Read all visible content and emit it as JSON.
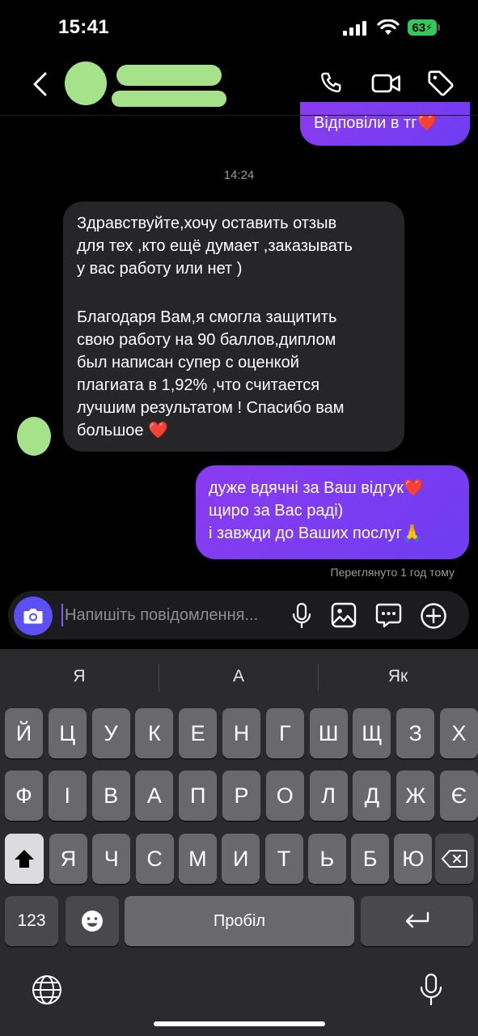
{
  "status_bar": {
    "time": "15:41",
    "battery": "63"
  },
  "chat": {
    "previous_out": "Відповіли в тг❤️",
    "timestamp": "14:24",
    "incoming": {
      "paragraph1": [
        "Здравствуйте,хочу оставить отзыв",
        "для тех ,кто ещё думает ,заказывать",
        "у вас работу или нет )"
      ],
      "paragraph2": [
        "Благодаря Вам,я смогла защитить",
        "свою работу на 90 баллов,диплом",
        "был написан супер с оценкой",
        "плагиата в 1,92% ,что считается",
        "лучшим результатом ! Спасибо вам",
        "большое ❤️"
      ]
    },
    "outgoing": [
      "дуже вдячні за Ваш відгук❤️",
      "щиро за Вас раді)",
      "і завжди до Ваших послуг🙏"
    ],
    "seen": "Переглянуто 1 год тому"
  },
  "composer": {
    "placeholder": "Напишіть повідомлення..."
  },
  "keyboard": {
    "suggestions": [
      "Я",
      "А",
      "Як"
    ],
    "row1": [
      "Й",
      "Ц",
      "У",
      "К",
      "Е",
      "Н",
      "Г",
      "Ш",
      "Щ",
      "З",
      "Х"
    ],
    "row2": [
      "Ф",
      "І",
      "В",
      "А",
      "П",
      "Р",
      "О",
      "Л",
      "Д",
      "Ж",
      "Є"
    ],
    "row3": [
      "Я",
      "Ч",
      "С",
      "М",
      "И",
      "Т",
      "Ь",
      "Б",
      "Ю"
    ],
    "numbers_label": "123",
    "space_label": "Пробіл"
  },
  "icons": {
    "back": "chevron-left-icon",
    "call": "phone-icon",
    "video": "video-icon",
    "tag": "tag-icon",
    "camera": "camera-icon",
    "mic": "mic-icon",
    "gallery": "image-icon",
    "sticker": "chat-bubble-icon",
    "plus": "plus-circle-icon"
  },
  "colors": {
    "accent": "#7c3aed",
    "battery": "#34c759"
  }
}
